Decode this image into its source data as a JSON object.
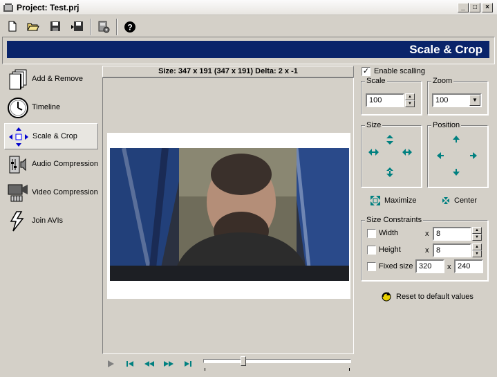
{
  "window": {
    "title": "Project: Test.prj"
  },
  "header": {
    "banner_title": "Scale & Crop"
  },
  "sidebar": {
    "items": [
      {
        "label": "Add & Remove",
        "icon": "pages-icon"
      },
      {
        "label": "Timeline",
        "icon": "clock-icon"
      },
      {
        "label": "Scale & Crop",
        "icon": "scale-arrows-icon",
        "active": true
      },
      {
        "label": "Audio Compression",
        "icon": "audio-compression-icon"
      },
      {
        "label": "Video Compression",
        "icon": "video-compression-icon"
      },
      {
        "label": "Join AVIs",
        "icon": "lightning-icon"
      }
    ]
  },
  "preview": {
    "size_info": "Size: 347 x 191 (347 x 191) Delta: 2 x -1",
    "seek_position": 0.27
  },
  "panel": {
    "enable_scaling_label": "Enable scalling",
    "enable_scaling_checked": true,
    "scale": {
      "title": "Scale",
      "value": "100"
    },
    "zoom": {
      "title": "Zoom",
      "value": "100"
    },
    "size_title": "Size",
    "position_title": "Position",
    "maximize_label": "Maximize",
    "center_label": "Center",
    "constraints": {
      "title": "Size Constraints",
      "width_label": "Width",
      "width_x": "x",
      "width_value": "8",
      "height_label": "Height",
      "height_x": "x",
      "height_value": "8",
      "fixed_label": "Fixed size",
      "fixed_width": "320",
      "fixed_x": "x",
      "fixed_height": "240"
    },
    "reset_label": "Reset to default values"
  },
  "colors": {
    "banner": "#0a246a",
    "arrows": "#008080",
    "face": "#d4d0c8"
  }
}
